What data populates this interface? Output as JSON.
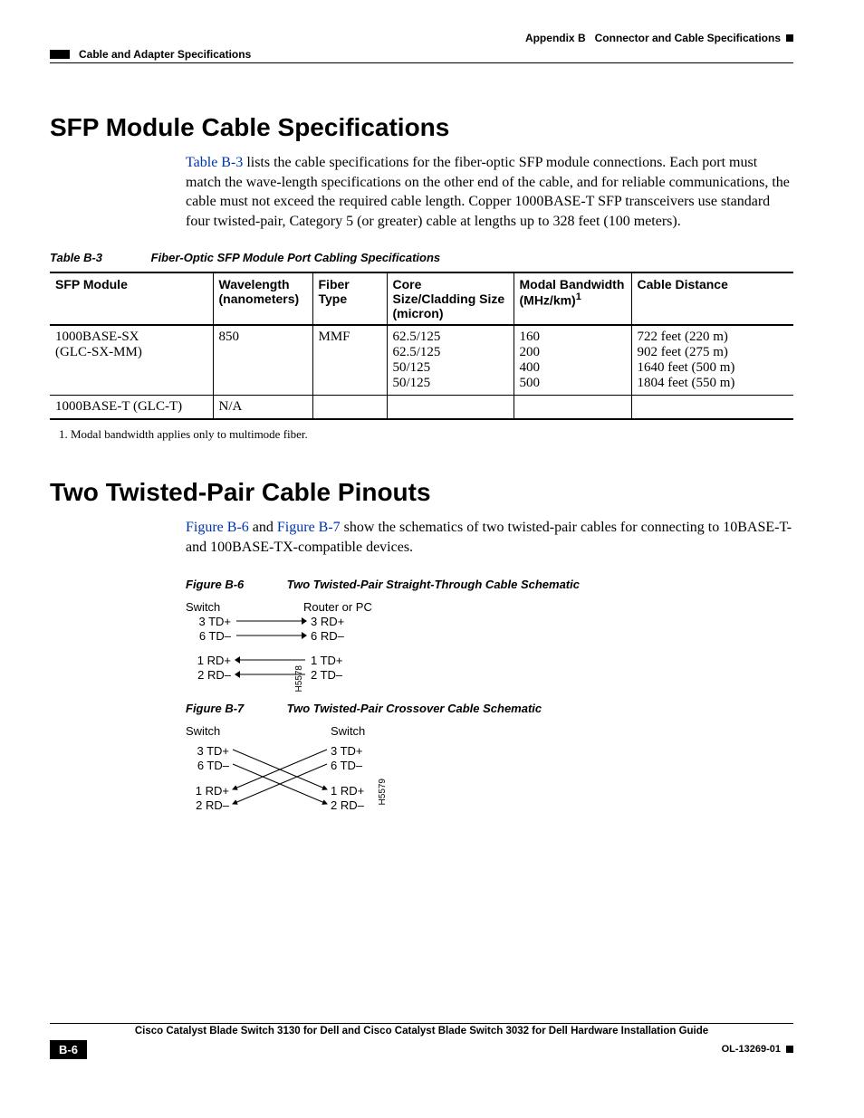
{
  "header": {
    "appendix": "Appendix B",
    "appendix_title": "Connector and Cable Specifications",
    "section_running": "Cable and Adapter Specifications"
  },
  "section1": {
    "title": "SFP Module Cable Specifications",
    "para_link": "Table B-3",
    "para_rest": " lists the cable specifications for the fiber-optic SFP module connections. Each port must match the wave-length specifications on the other end of the cable, and for reliable communications, the cable must not exceed the required cable length. Copper 1000BASE-T SFP transceivers use standard four twisted-pair, Category 5 (or greater) cable at lengths up to 328 feet (100 meters).",
    "table": {
      "caption_num": "Table B-3",
      "caption_text": "Fiber-Optic SFP Module Port Cabling Specifications",
      "headers": [
        "SFP Module",
        "Wavelength (nanometers)",
        "Fiber Type",
        "Core Size/Cladding Size (micron)",
        "Modal Bandwidth (MHz/km)",
        "Cable Distance"
      ],
      "header_sup": "1",
      "rows": [
        {
          "cells": [
            "1000BASE-SX\n(GLC-SX-MM)",
            "850",
            "MMF",
            "62.5/125\n62.5/125\n50/125\n50/125",
            "160\n200\n400\n500",
            "722 feet (220 m)\n902 feet (275 m)\n1640 feet (500 m)\n1804 feet (550 m)"
          ]
        },
        {
          "cells": [
            "1000BASE-T (GLC-T)",
            "N/A",
            "",
            "",
            "",
            ""
          ]
        }
      ],
      "footnote": "1. Modal bandwidth applies only to multimode fiber."
    }
  },
  "section2": {
    "title": "Two Twisted-Pair Cable Pinouts",
    "para_link1": "Figure B-6",
    "para_mid": " and ",
    "para_link2": "Figure B-7",
    "para_rest": " show the schematics of two twisted-pair cables for connecting to 10BASE-T- and 100BASE-TX-compatible devices.",
    "fig1": {
      "caption_num": "Figure B-6",
      "caption_text": "Two Twisted-Pair Straight-Through Cable Schematic",
      "head_left": "Switch",
      "head_right": "Router or PC",
      "rows": [
        {
          "l": "3 TD+",
          "r": "3 RD+",
          "dir": "right"
        },
        {
          "l": "6 TD–",
          "r": "6 RD–",
          "dir": "right"
        },
        {
          "l": "1 RD+",
          "r": "1 TD+",
          "dir": "left"
        },
        {
          "l": "2 RD–",
          "r": "2 TD–",
          "dir": "left"
        }
      ],
      "side": "H5578"
    },
    "fig2": {
      "caption_num": "Figure B-7",
      "caption_text": "Two Twisted-Pair Crossover Cable Schematic",
      "head_left": "Switch",
      "head_right": "Switch",
      "labels": {
        "l1": "3 TD+",
        "r1": "3 TD+",
        "l2": "6 TD–",
        "r2": "6 TD–",
        "l3": "1 RD+",
        "r3": "1 RD+",
        "l4": "2 RD–",
        "r4": "2 RD–"
      },
      "side": "H5579"
    }
  },
  "footer": {
    "doc_title": "Cisco Catalyst Blade Switch 3130 for Dell and Cisco Catalyst Blade Switch 3032 for Dell Hardware Installation Guide",
    "page": "B-6",
    "doc_id": "OL-13269-01"
  }
}
